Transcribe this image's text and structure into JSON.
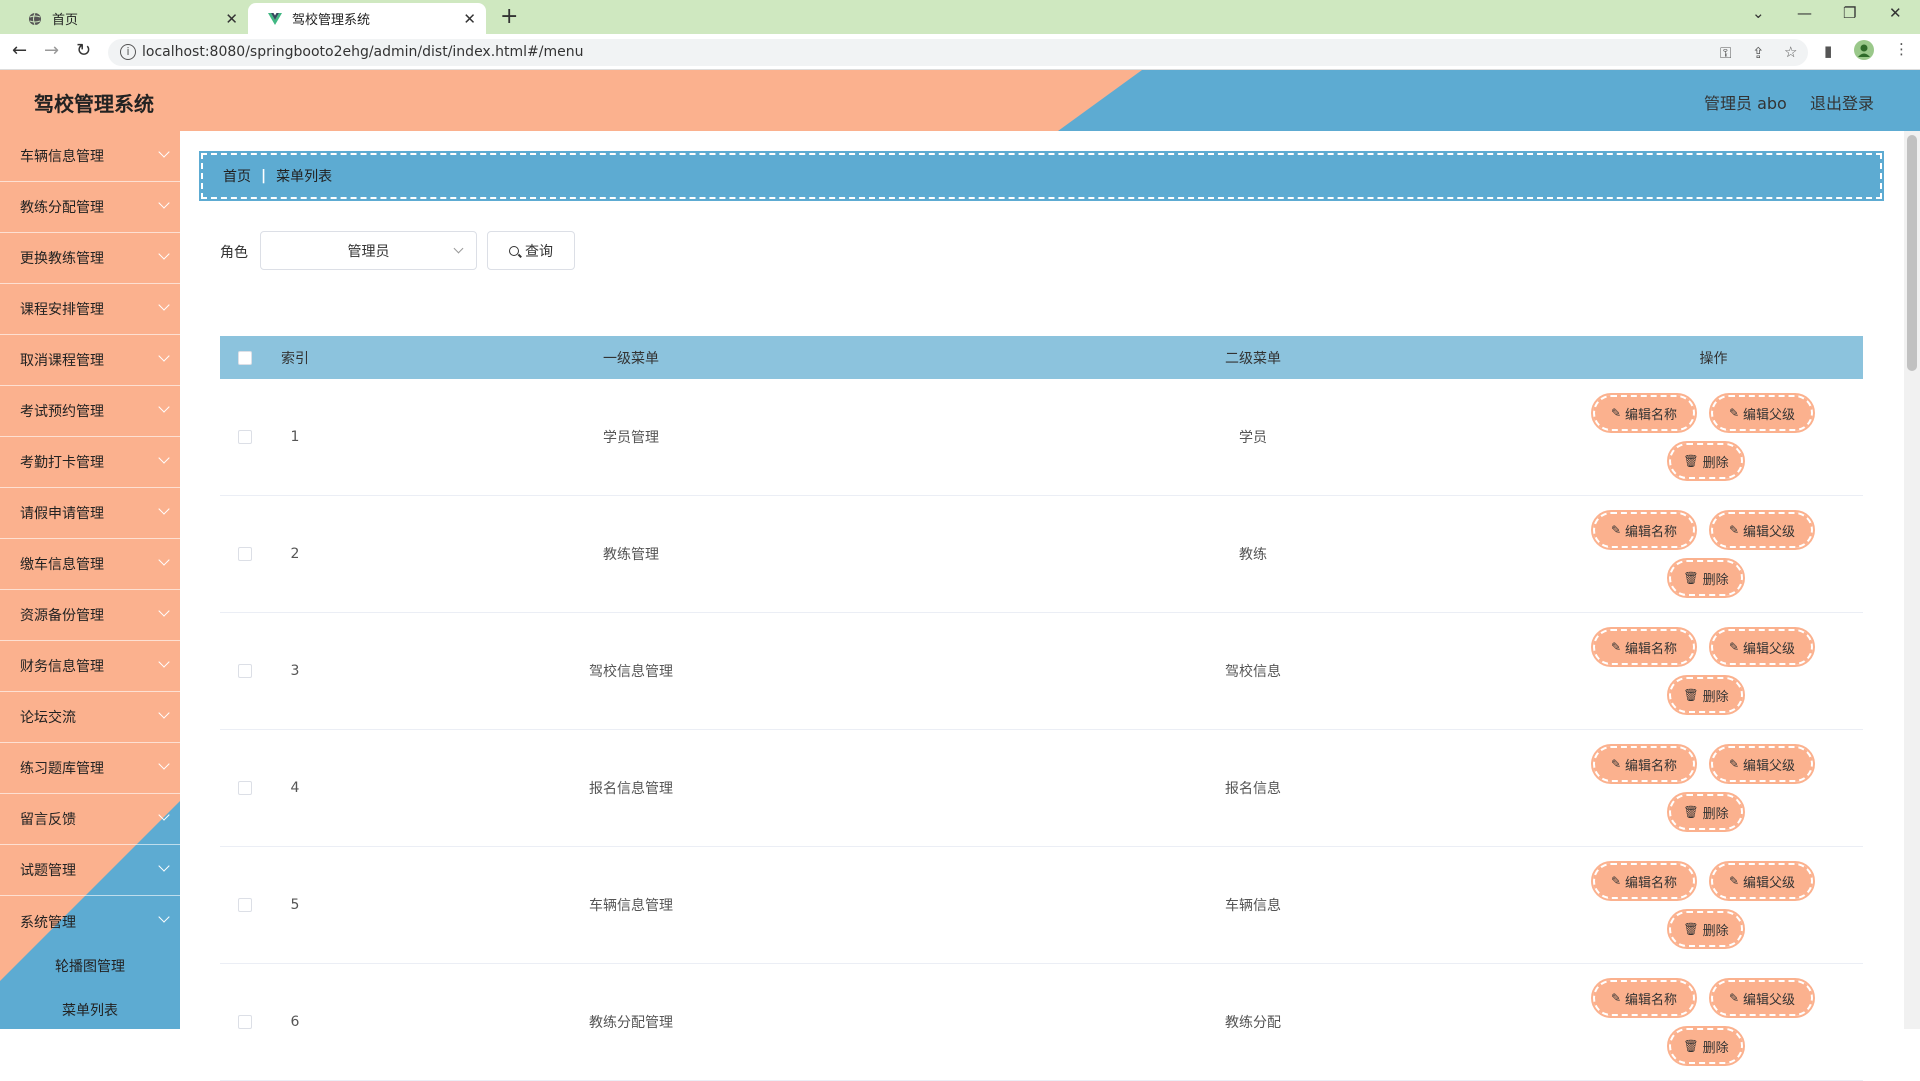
{
  "browser": {
    "tabs": [
      {
        "title": "首页",
        "active": false
      },
      {
        "title": "驾校管理系统",
        "active": true
      }
    ],
    "url": "localhost:8080/springbooto2ehg/admin/dist/index.html#/menu"
  },
  "header": {
    "title": "驾校管理系统",
    "user_label": "管理员 abo",
    "logout_label": "退出登录"
  },
  "sidebar": {
    "items": [
      {
        "label": "车辆信息管理"
      },
      {
        "label": "教练分配管理"
      },
      {
        "label": "更换教练管理"
      },
      {
        "label": "课程安排管理"
      },
      {
        "label": "取消课程管理"
      },
      {
        "label": "考试预约管理"
      },
      {
        "label": "考勤打卡管理"
      },
      {
        "label": "请假申请管理"
      },
      {
        "label": "缴车信息管理"
      },
      {
        "label": "资源备份管理"
      },
      {
        "label": "财务信息管理"
      },
      {
        "label": "论坛交流"
      },
      {
        "label": "练习题库管理"
      },
      {
        "label": "留言反馈"
      },
      {
        "label": "试题管理"
      },
      {
        "label": "系统管理"
      }
    ],
    "sub_items": [
      {
        "label": "轮播图管理"
      },
      {
        "label": "菜单列表"
      }
    ]
  },
  "breadcrumb": {
    "home": "首页",
    "current": "菜单列表"
  },
  "filter": {
    "role_label": "角色",
    "role_value": "管理员",
    "query_label": "查询"
  },
  "table": {
    "headers": {
      "index": "索引",
      "level1": "一级菜单",
      "level2": "二级菜单",
      "ops": "操作"
    },
    "op_labels": {
      "edit_name": "编辑名称",
      "edit_parent": "编辑父级",
      "delete": "删除"
    },
    "rows": [
      {
        "index": "1",
        "level1": "学员管理",
        "level2": "学员"
      },
      {
        "index": "2",
        "level1": "教练管理",
        "level2": "教练"
      },
      {
        "index": "3",
        "level1": "驾校信息管理",
        "level2": "驾校信息"
      },
      {
        "index": "4",
        "level1": "报名信息管理",
        "level2": "报名信息"
      },
      {
        "index": "5",
        "level1": "车辆信息管理",
        "level2": "车辆信息"
      },
      {
        "index": "6",
        "level1": "教练分配管理",
        "level2": "教练分配"
      }
    ]
  },
  "colors": {
    "accent_blue": "#5dabd2",
    "accent_salmon": "#fbb18e",
    "table_header": "#8cc3dd"
  }
}
